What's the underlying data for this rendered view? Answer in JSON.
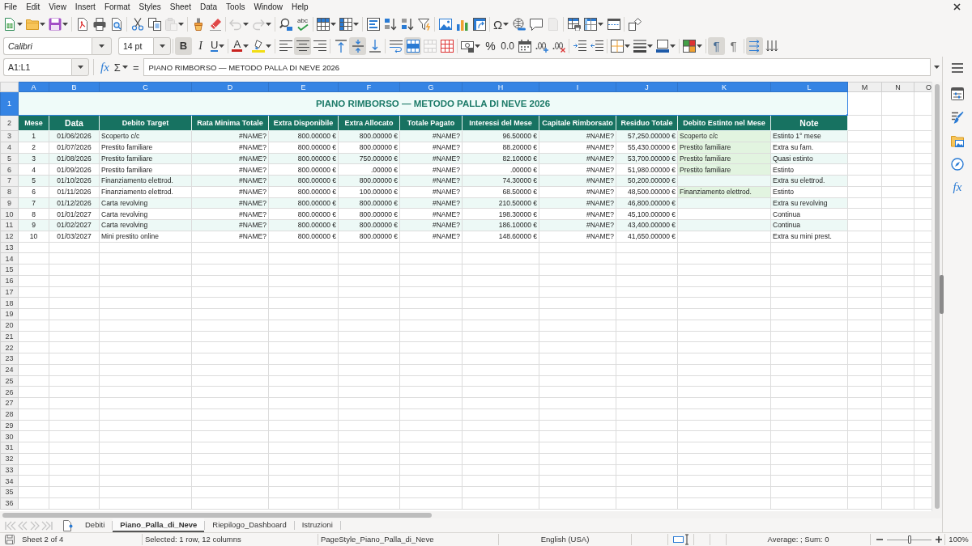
{
  "menu_bar": {
    "items": [
      "File",
      "Edit",
      "View",
      "Insert",
      "Format",
      "Styles",
      "Sheet",
      "Data",
      "Tools",
      "Window",
      "Help"
    ]
  },
  "standard_toolbar": {
    "groups": [
      [
        {
          "kind": "new",
          "disabled": false
        },
        {
          "kind": "open",
          "disabled": false
        },
        {
          "kind": "save",
          "disabled": false
        }
      ],
      [
        {
          "kind": "export_pdf",
          "disabled": false
        },
        {
          "kind": "print",
          "disabled": false
        },
        {
          "kind": "print_preview",
          "disabled": false
        }
      ],
      [
        {
          "kind": "cut",
          "disabled": false
        },
        {
          "kind": "copy",
          "disabled": false
        },
        {
          "kind": "paste",
          "disabled": true
        }
      ],
      [
        {
          "kind": "clone_formatting",
          "disabled": false
        },
        {
          "kind": "clear_formatting",
          "disabled": false
        }
      ],
      [
        {
          "kind": "undo",
          "disabled": true
        },
        {
          "kind": "redo",
          "disabled": true
        }
      ],
      [
        {
          "kind": "find_replace",
          "disabled": false
        },
        {
          "kind": "spelling",
          "label": "abc",
          "disabled": false
        }
      ],
      [
        {
          "kind": "rows",
          "disabled": false
        },
        {
          "kind": "columns",
          "disabled": false
        }
      ],
      [
        {
          "kind": "sort",
          "disabled": false
        },
        {
          "kind": "sort_ascending",
          "disabled": false
        },
        {
          "kind": "sort_descending",
          "disabled": false
        },
        {
          "kind": "autofilter",
          "disabled": false
        }
      ],
      [
        {
          "kind": "image",
          "disabled": false
        },
        {
          "kind": "chart",
          "disabled": false
        },
        {
          "kind": "pivot_table",
          "disabled": false
        }
      ],
      [
        {
          "kind": "special_character",
          "label": "Ω",
          "disabled": false
        },
        {
          "kind": "hyperlink",
          "disabled": false
        },
        {
          "kind": "comment",
          "disabled": false
        },
        {
          "kind": "header_footer",
          "disabled": true
        }
      ],
      [
        {
          "kind": "print_area",
          "disabled": false
        },
        {
          "kind": "freeze",
          "disabled": false
        },
        {
          "kind": "split_window",
          "disabled": false
        }
      ],
      [
        {
          "kind": "draw_functions",
          "disabled": false
        }
      ]
    ]
  },
  "formatting_toolbar": {
    "font_name": {
      "value": "Calibri"
    },
    "font_size": {
      "value": "14 pt"
    },
    "groups": [
      [
        {
          "kind": "bold",
          "label": "B",
          "pressed": true,
          "disabled": false
        },
        {
          "kind": "italic",
          "label": "I",
          "pressed": false,
          "disabled": false
        },
        {
          "kind": "underline",
          "label": "U",
          "pressed": false,
          "disabled": false
        }
      ],
      [
        {
          "kind": "font_color",
          "label": "A",
          "pressed": false,
          "disabled": false
        },
        {
          "kind": "highlighting",
          "pressed": false,
          "disabled": false
        }
      ],
      [
        {
          "kind": "align_left",
          "pressed": false,
          "disabled": false
        },
        {
          "kind": "align_center",
          "pressed": true,
          "disabled": false
        },
        {
          "kind": "align_right",
          "pressed": false,
          "disabled": false
        }
      ],
      [
        {
          "kind": "align_top",
          "pressed": false,
          "disabled": false
        },
        {
          "kind": "align_middle",
          "pressed": true,
          "disabled": false
        },
        {
          "kind": "align_bottom",
          "pressed": false,
          "disabled": false
        }
      ],
      [
        {
          "kind": "wrap_text",
          "pressed": false,
          "disabled": false
        },
        {
          "kind": "merge_center",
          "pressed": true,
          "disabled": false
        },
        {
          "kind": "merge_cells",
          "pressed": false,
          "disabled": true
        },
        {
          "kind": "unmerge_cells",
          "pressed": false,
          "disabled": false
        }
      ],
      [
        {
          "kind": "currency",
          "pressed": false,
          "disabled": false
        },
        {
          "kind": "percent",
          "label": "%",
          "pressed": false,
          "disabled": false
        },
        {
          "kind": "number",
          "label": "0.0",
          "pressed": false,
          "disabled": false
        },
        {
          "kind": "date",
          "pressed": false,
          "disabled": false
        },
        {
          "kind": "add_decimal",
          "pressed": false,
          "disabled": false
        },
        {
          "kind": "delete_decimal",
          "pressed": false,
          "disabled": false
        }
      ],
      [
        {
          "kind": "indent_increase",
          "pressed": false,
          "disabled": false
        },
        {
          "kind": "indent_decrease",
          "pressed": false,
          "disabled": false
        }
      ],
      [
        {
          "kind": "borders",
          "pressed": false,
          "disabled": false
        },
        {
          "kind": "border_style",
          "pressed": false,
          "disabled": false
        },
        {
          "kind": "border_color",
          "pressed": false,
          "disabled": false
        }
      ],
      [
        {
          "kind": "conditional_format",
          "pressed": false,
          "disabled": false
        }
      ],
      [
        {
          "kind": "left_to_right",
          "label": "¶",
          "pressed": true,
          "disabled": false
        },
        {
          "kind": "right_to_left",
          "label": "¶",
          "pressed": false,
          "disabled": false
        }
      ],
      [
        {
          "kind": "text_left_to_right",
          "pressed": true,
          "disabled": false
        },
        {
          "kind": "text_top_to_bottom",
          "pressed": false,
          "disabled": false
        }
      ]
    ]
  },
  "formula_bar": {
    "name_box": {
      "value": "A1:L1"
    },
    "function_wizard": "fx",
    "sum": "Σ",
    "equals": "=",
    "formula": {
      "value": "PIANO RIMBORSO — METODO PALLA DI NEVE 2026"
    }
  },
  "sidebar": {
    "buttons": [
      {
        "kind": "properties"
      },
      {
        "kind": "styles"
      },
      {
        "kind": "gallery"
      },
      {
        "kind": "navigator"
      },
      {
        "kind": "functions",
        "label": "fx"
      }
    ]
  },
  "sheet": {
    "columns": [
      {
        "label": "A",
        "selected": true
      },
      {
        "label": "B",
        "selected": true
      },
      {
        "label": "C",
        "selected": true
      },
      {
        "label": "D",
        "selected": true
      },
      {
        "label": "E",
        "selected": true
      },
      {
        "label": "F",
        "selected": true
      },
      {
        "label": "G",
        "selected": true
      },
      {
        "label": "H",
        "selected": true
      },
      {
        "label": "I",
        "selected": true
      },
      {
        "label": "J",
        "selected": true
      },
      {
        "label": "K",
        "selected": true
      },
      {
        "label": "L",
        "selected": true
      },
      {
        "label": "M",
        "selected": false
      },
      {
        "label": "N",
        "selected": false
      },
      {
        "label": "O",
        "selected": false
      }
    ],
    "row_headers": [
      {
        "number": "1",
        "selected": true
      },
      {
        "number": "2",
        "selected": false
      },
      {
        "number": "3",
        "selected": false
      },
      {
        "number": "4",
        "selected": false
      },
      {
        "number": "5",
        "selected": false
      },
      {
        "number": "6",
        "selected": false
      },
      {
        "number": "7",
        "selected": false
      },
      {
        "number": "8",
        "selected": false
      },
      {
        "number": "9",
        "selected": false
      },
      {
        "number": "10",
        "selected": false
      },
      {
        "number": "11",
        "selected": false
      },
      {
        "number": "12",
        "selected": false
      },
      {
        "number": "13",
        "selected": false
      },
      {
        "number": "14",
        "selected": false
      },
      {
        "number": "15",
        "selected": false
      },
      {
        "number": "16",
        "selected": false
      },
      {
        "number": "17",
        "selected": false
      },
      {
        "number": "18",
        "selected": false
      },
      {
        "number": "19",
        "selected": false
      },
      {
        "number": "20",
        "selected": false
      },
      {
        "number": "21",
        "selected": false
      },
      {
        "number": "22",
        "selected": false
      },
      {
        "number": "23",
        "selected": false
      },
      {
        "number": "24",
        "selected": false
      },
      {
        "number": "25",
        "selected": false
      },
      {
        "number": "26",
        "selected": false
      },
      {
        "number": "27",
        "selected": false
      },
      {
        "number": "28",
        "selected": false
      },
      {
        "number": "29",
        "selected": false
      },
      {
        "number": "30",
        "selected": false
      },
      {
        "number": "31",
        "selected": false
      },
      {
        "number": "32",
        "selected": false
      },
      {
        "number": "33",
        "selected": false
      },
      {
        "number": "34",
        "selected": false
      },
      {
        "number": "35",
        "selected": false
      },
      {
        "number": "36",
        "selected": false
      }
    ],
    "title": "PIANO RIMBORSO — METODO PALLA DI NEVE 2026",
    "headers": [
      "Mese",
      "Data",
      "Debito Target",
      "Rata Minima Totale",
      "Extra Disponibile",
      "Extra Allocato",
      "Totale Pagato",
      "Interessi del Mese",
      "Capitale Rimborsato",
      "Residuo Totale",
      "Debito Estinto nel Mese",
      "Note"
    ],
    "data_rows": [
      {
        "mese": "1",
        "data": "01/06/2026",
        "debito_target": "Scoperto c/c",
        "rata_minima_totale": "#NAME?",
        "extra_disponibile": "800.00000 €",
        "extra_allocato": "800.00000 €",
        "totale_pagato": "#NAME?",
        "interessi_del_mese": "96.50000 €",
        "capitale_rimborsato": "#NAME?",
        "residuo_totale": "57,250.00000 €",
        "debito_estinto_nel_mese": "Scoperto c/c",
        "note": "Estinto 1° mese",
        "debito_estinto_highlighted": true
      },
      {
        "mese": "2",
        "data": "01/07/2026",
        "debito_target": "Prestito familiare",
        "rata_minima_totale": "#NAME?",
        "extra_disponibile": "800.00000 €",
        "extra_allocato": "800.00000 €",
        "totale_pagato": "#NAME?",
        "interessi_del_mese": "88.20000 €",
        "capitale_rimborsato": "#NAME?",
        "residuo_totale": "55,430.00000 €",
        "debito_estinto_nel_mese": "Prestito familiare",
        "note": "Extra su fam.",
        "debito_estinto_highlighted": true
      },
      {
        "mese": "3",
        "data": "01/08/2026",
        "debito_target": "Prestito familiare",
        "rata_minima_totale": "#NAME?",
        "extra_disponibile": "800.00000 €",
        "extra_allocato": "750.00000 €",
        "totale_pagato": "#NAME?",
        "interessi_del_mese": "82.10000 €",
        "capitale_rimborsato": "#NAME?",
        "residuo_totale": "53,700.00000 €",
        "debito_estinto_nel_mese": "Prestito familiare",
        "note": "Quasi estinto",
        "debito_estinto_highlighted": true
      },
      {
        "mese": "4",
        "data": "01/09/2026",
        "debito_target": "Prestito familiare",
        "rata_minima_totale": "#NAME?",
        "extra_disponibile": "800.00000 €",
        "extra_allocato": ".00000 €",
        "totale_pagato": "#NAME?",
        "interessi_del_mese": ".00000 €",
        "capitale_rimborsato": "#NAME?",
        "residuo_totale": "51,980.00000 €",
        "debito_estinto_nel_mese": "Prestito familiare",
        "note": "Estinto",
        "debito_estinto_highlighted": true
      },
      {
        "mese": "5",
        "data": "01/10/2026",
        "debito_target": "Finanziamento elettrod.",
        "rata_minima_totale": "#NAME?",
        "extra_disponibile": "800.00000 €",
        "extra_allocato": "800.00000 €",
        "totale_pagato": "#NAME?",
        "interessi_del_mese": "74.30000 €",
        "capitale_rimborsato": "#NAME?",
        "residuo_totale": "50,200.00000 €",
        "note": "Extra su elettrod.",
        "debito_estinto_highlighted": false
      },
      {
        "mese": "6",
        "data": "01/11/2026",
        "debito_target": "Finanziamento elettrod.",
        "rata_minima_totale": "#NAME?",
        "extra_disponibile": "800.00000 €",
        "extra_allocato": "100.00000 €",
        "totale_pagato": "#NAME?",
        "interessi_del_mese": "68.50000 €",
        "capitale_rimborsato": "#NAME?",
        "residuo_totale": "48,500.00000 €",
        "debito_estinto_nel_mese": "Finanziamento elettrod.",
        "note": "Estinto",
        "debito_estinto_highlighted": true
      },
      {
        "mese": "7",
        "data": "01/12/2026",
        "debito_target": "Carta revolving",
        "rata_minima_totale": "#NAME?",
        "extra_disponibile": "800.00000 €",
        "extra_allocato": "800.00000 €",
        "totale_pagato": "#NAME?",
        "interessi_del_mese": "210.50000 €",
        "capitale_rimborsato": "#NAME?",
        "residuo_totale": "46,800.00000 €",
        "note": "Extra su revolving",
        "debito_estinto_highlighted": false
      },
      {
        "mese": "8",
        "data": "01/01/2027",
        "debito_target": "Carta revolving",
        "rata_minima_totale": "#NAME?",
        "extra_disponibile": "800.00000 €",
        "extra_allocato": "800.00000 €",
        "totale_pagato": "#NAME?",
        "interessi_del_mese": "198.30000 €",
        "capitale_rimborsato": "#NAME?",
        "residuo_totale": "45,100.00000 €",
        "note": "Continua",
        "debito_estinto_highlighted": false
      },
      {
        "mese": "9",
        "data": "01/02/2027",
        "debito_target": "Carta revolving",
        "rata_minima_totale": "#NAME?",
        "extra_disponibile": "800.00000 €",
        "extra_allocato": "800.00000 €",
        "totale_pagato": "#NAME?",
        "interessi_del_mese": "186.10000 €",
        "capitale_rimborsato": "#NAME?",
        "residuo_totale": "43,400.00000 €",
        "note": "Continua",
        "debito_estinto_highlighted": false
      },
      {
        "mese": "10",
        "data": "01/03/2027",
        "debito_target": "Mini prestito online",
        "rata_minima_totale": "#NAME?",
        "extra_disponibile": "800.00000 €",
        "extra_allocato": "800.00000 €",
        "totale_pagato": "#NAME?",
        "interessi_del_mese": "148.60000 €",
        "capitale_rimborsato": "#NAME?",
        "residuo_totale": "41,650.00000 €",
        "note": "Extra su mini prest.",
        "debito_estinto_highlighted": false
      }
    ]
  },
  "sheet_tabs": {
    "navigation": [
      {
        "kind": "first",
        "disabled": true
      },
      {
        "kind": "previous",
        "disabled": true
      },
      {
        "kind": "next",
        "disabled": true
      },
      {
        "kind": "last",
        "disabled": true
      }
    ],
    "tabs": [
      {
        "label": "Debiti",
        "selected": false
      },
      {
        "label": "Piano_Palla_di_Neve",
        "selected": true
      },
      {
        "label": "Riepilogo_Dashboard",
        "selected": false
      },
      {
        "label": "Istruzioni",
        "selected": false
      }
    ]
  },
  "status_bar": {
    "sheet": "Sheet 2 of 4",
    "selection": "Selected: 1 row, 12 columns",
    "page_style": "PageStyle_Piano_Palla_di_Neve",
    "language": "English (USA)",
    "summary": "Average: ; Sum: 0",
    "zoom": {
      "level": 0.5,
      "reading": "100%"
    }
  }
}
